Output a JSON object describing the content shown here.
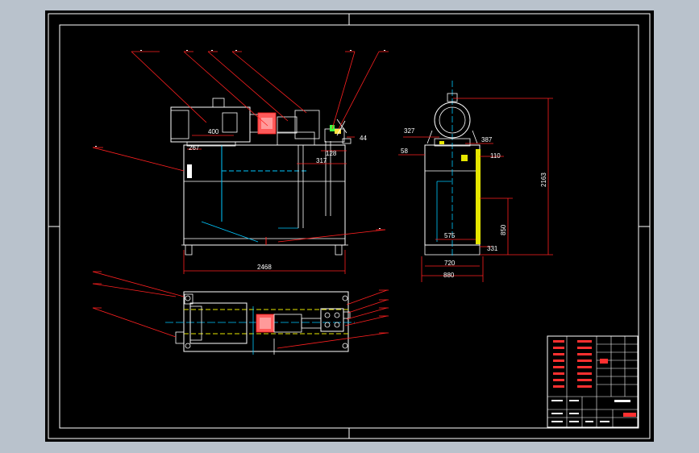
{
  "colors": {
    "viewport_bg": "#b9c2cc",
    "drawing_bg": "#000000",
    "frame_line": "#ffffff",
    "leader_red": "#ff2020",
    "centerline_cyan": "#00c8ff",
    "part_yellow": "#e6e600",
    "part_orange": "#ff8a30",
    "part_green": "#40ff40"
  },
  "front_view": {
    "dims": [
      "400",
      "267",
      "128",
      "317",
      "44",
      "2468"
    ]
  },
  "side_view": {
    "dims": [
      "327",
      "387",
      "58",
      "110",
      "2163",
      "850",
      "575",
      "331",
      "720",
      "880"
    ]
  },
  "top_view": {},
  "title_block": {
    "icons": [
      "title-block-grid"
    ]
  }
}
